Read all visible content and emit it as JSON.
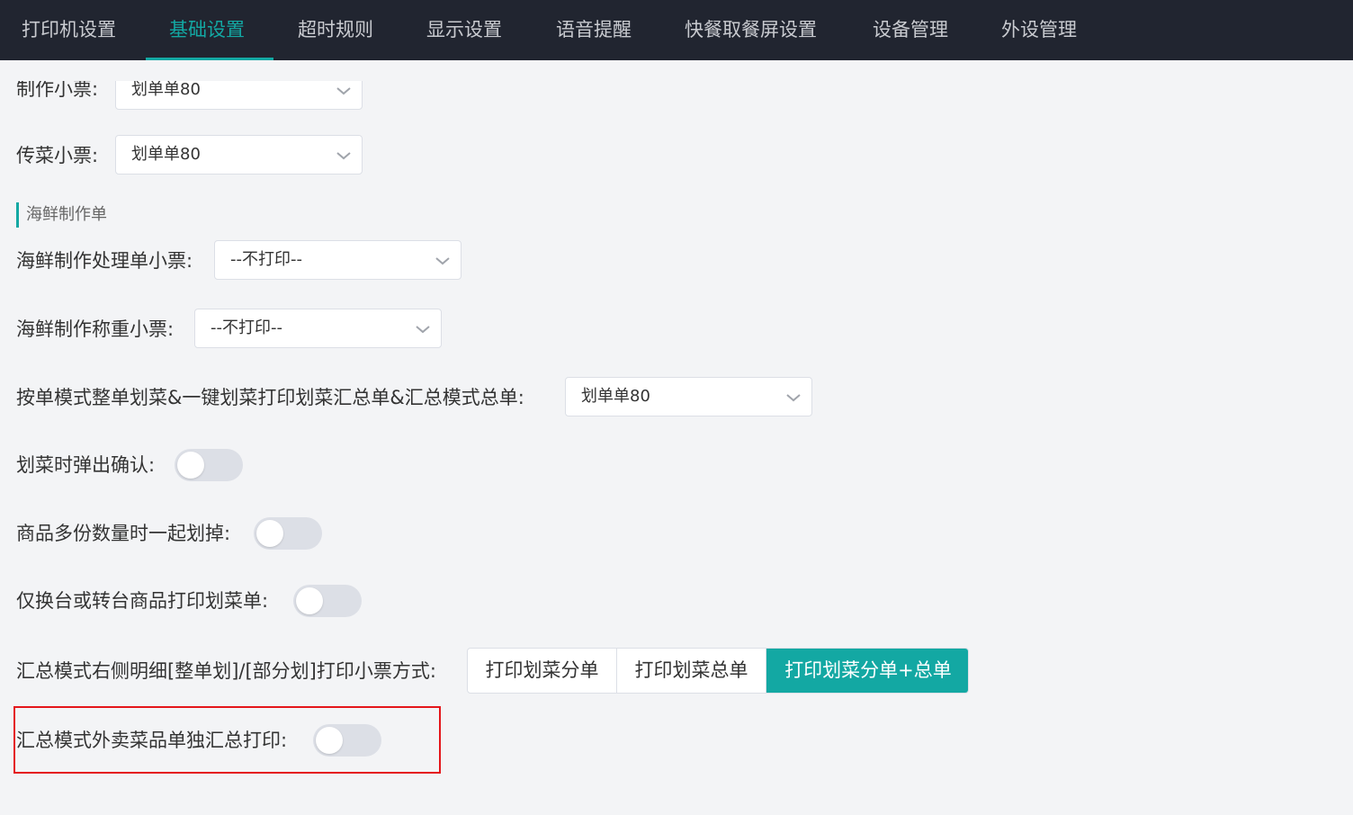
{
  "nav": {
    "tabs": [
      {
        "label": "打印机设置"
      },
      {
        "label": "基础设置"
      },
      {
        "label": "超时规则"
      },
      {
        "label": "显示设置"
      },
      {
        "label": "语音提醒"
      },
      {
        "label": "快餐取餐屏设置"
      },
      {
        "label": "设备管理"
      },
      {
        "label": "外设管理"
      }
    ],
    "active_tab": "基础设置",
    "accent_color": "#13a8a3"
  },
  "form": {
    "make_ticket": {
      "label": "制作小票:",
      "value": "划单单80"
    },
    "serve_ticket": {
      "label": "传菜小票:",
      "value": "划单单80"
    },
    "seafood_section": {
      "title": "海鲜制作单"
    },
    "seafood_process": {
      "label": "海鲜制作处理单小票:",
      "value": "--不打印--"
    },
    "seafood_weigh": {
      "label": "海鲜制作称重小票:",
      "value": "--不打印--"
    },
    "summary_order": {
      "label": "按单模式整单划菜&一键划菜打印划菜汇总单&汇总模式总单:",
      "value": "划单单80"
    },
    "confirm_popup": {
      "label": "划菜时弹出确认:",
      "on": false
    },
    "multi_qty": {
      "label": "商品多份数量时一起划掉:",
      "on": false
    },
    "table_change_only": {
      "label": "仅换台或转台商品打印划菜单:",
      "on": false
    },
    "print_mode": {
      "label": "汇总模式右侧明细[整单划]/[部分划]打印小票方式:",
      "options": [
        {
          "label": "打印划菜分单"
        },
        {
          "label": "打印划菜总单"
        },
        {
          "label": "打印划菜分单+总单"
        }
      ],
      "selected": "打印划菜分单+总单"
    },
    "takeout_separate": {
      "label": "汇总模式外卖菜品单独汇总打印:",
      "on": false
    }
  }
}
